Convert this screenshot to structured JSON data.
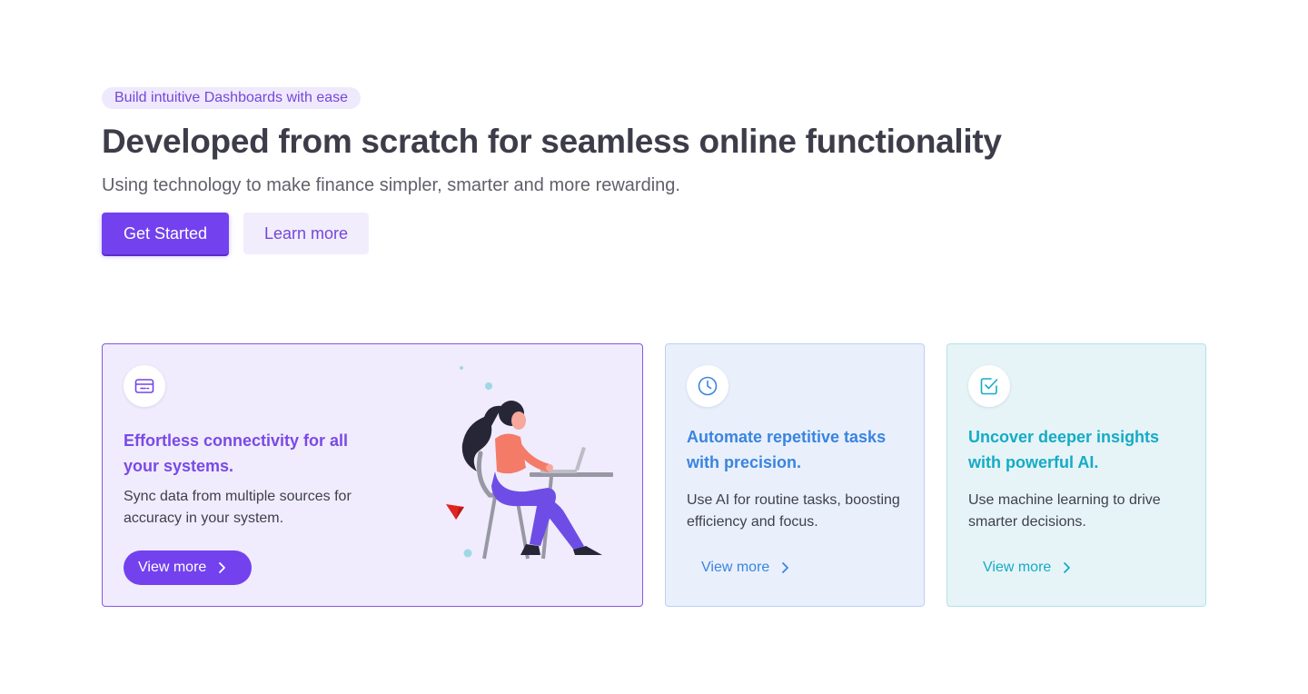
{
  "hero": {
    "badge": "Build intuitive Dashboards with ease",
    "headline": "Developed from scratch for seamless online functionality",
    "subline": "Using technology to make finance simpler, smarter and more rewarding.",
    "primary_cta": "Get Started",
    "secondary_cta": "Learn more"
  },
  "cards": [
    {
      "icon": "credit-card-icon",
      "title": "Effortless connectivity for all your systems.",
      "description": "Sync data from multiple sources for accuracy in your system.",
      "link": "View more",
      "accent": "#7342ee"
    },
    {
      "icon": "clock-icon",
      "title": "Automate repetitive tasks with precision.",
      "description": "Use AI for routine tasks, boosting efficiency and focus.",
      "link": "View more",
      "accent": "#3a84e0"
    },
    {
      "icon": "check-square-icon",
      "title": "Uncover deeper insights with powerful AI.",
      "description": "Use machine learning to drive smarter decisions.",
      "link": "View more",
      "accent": "#15abc6"
    }
  ]
}
